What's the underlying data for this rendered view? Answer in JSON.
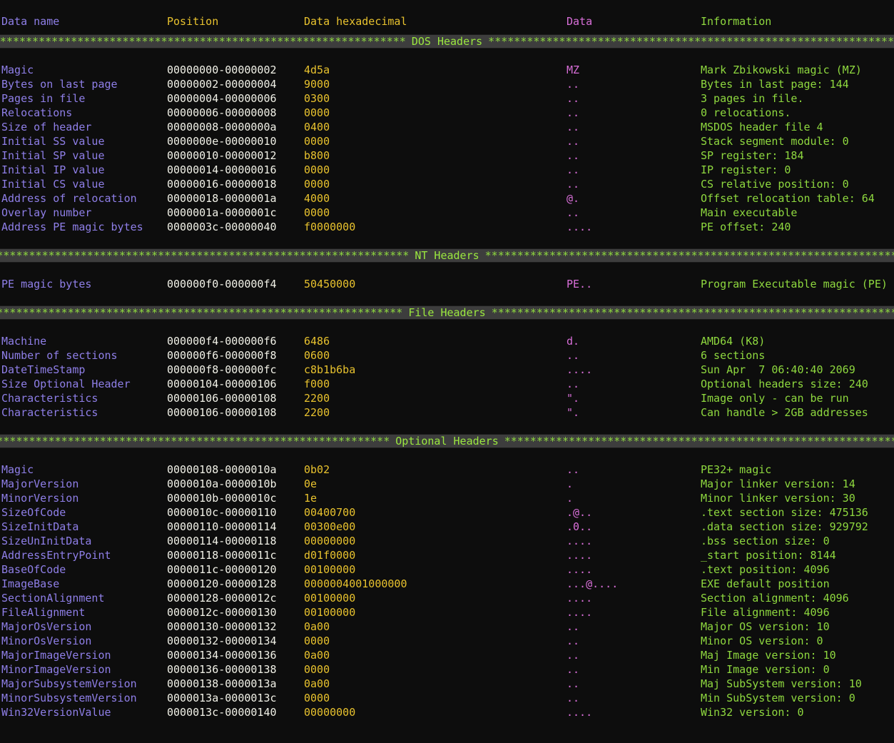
{
  "window": {
    "type": "terminal",
    "background": "#0d0d0d",
    "title": "PE file header dump"
  },
  "colors": {
    "data_name": "#8f7fe8",
    "position": "#f2f2e8",
    "data_hex": "#e8c22e",
    "data_ascii": "#d96fd9",
    "information": "#8fd93f",
    "separator_bar": "#3d3d3d",
    "background": "#0d0d0d"
  },
  "columns": {
    "data_name": "Data name",
    "position": "Position",
    "data_hexadecimal": "Data hexadecimal",
    "data": "Data",
    "information": "Information"
  },
  "sections": [
    {
      "title": "DOS Headers",
      "rows": [
        {
          "name": "Magic",
          "position": "00000000-00000002",
          "hex": "4d5a",
          "data": "MZ",
          "info": "Mark Zbikowski magic (MZ)"
        },
        {
          "name": "Bytes on last page",
          "position": "00000002-00000004",
          "hex": "9000",
          "data": "..",
          "info": "Bytes in last page: 144"
        },
        {
          "name": "Pages in file",
          "position": "00000004-00000006",
          "hex": "0300",
          "data": "..",
          "info": "3 pages in file."
        },
        {
          "name": "Relocations",
          "position": "00000006-00000008",
          "hex": "0000",
          "data": "..",
          "info": "0 relocations."
        },
        {
          "name": "Size of header",
          "position": "00000008-0000000a",
          "hex": "0400",
          "data": "..",
          "info": "MSDOS header file 4"
        },
        {
          "name": "Initial SS value",
          "position": "0000000e-00000010",
          "hex": "0000",
          "data": "..",
          "info": "Stack segment module: 0"
        },
        {
          "name": "Initial SP value",
          "position": "00000010-00000012",
          "hex": "b800",
          "data": "..",
          "info": "SP register: 184"
        },
        {
          "name": "Initial IP value",
          "position": "00000014-00000016",
          "hex": "0000",
          "data": "..",
          "info": "IP register: 0"
        },
        {
          "name": "Initial CS value",
          "position": "00000016-00000018",
          "hex": "0000",
          "data": "..",
          "info": "CS relative position: 0"
        },
        {
          "name": "Address of relocation",
          "position": "00000018-0000001a",
          "hex": "4000",
          "data": "@.",
          "info": "Offset relocation table: 64"
        },
        {
          "name": "Overlay number",
          "position": "0000001a-0000001c",
          "hex": "0000",
          "data": "..",
          "info": "Main executable"
        },
        {
          "name": "Address PE magic bytes",
          "position": "0000003c-00000040",
          "hex": "f0000000",
          "data": "....",
          "info": "PE offset: 240"
        }
      ]
    },
    {
      "title": "NT Headers",
      "rows": [
        {
          "name": "PE magic bytes",
          "position": "000000f0-000000f4",
          "hex": "50450000",
          "data": "PE..",
          "info": "Program Executable magic (PE)"
        }
      ]
    },
    {
      "title": "File Headers",
      "rows": [
        {
          "name": "Machine",
          "position": "000000f4-000000f6",
          "hex": "6486",
          "data": "d.",
          "info": "AMD64 (K8)"
        },
        {
          "name": "Number of sections",
          "position": "000000f6-000000f8",
          "hex": "0600",
          "data": "..",
          "info": "6 sections"
        },
        {
          "name": "DateTimeStamp",
          "position": "000000f8-000000fc",
          "hex": "c8b1b6ba",
          "data": "....",
          "info": "Sun Apr  7 06:40:40 2069"
        },
        {
          "name": "Size Optional Header",
          "position": "00000104-00000106",
          "hex": "f000",
          "data": "..",
          "info": "Optional headers size: 240"
        },
        {
          "name": "Characteristics",
          "position": "00000106-00000108",
          "hex": "2200",
          "data": "\".",
          "info": "Image only - can be run"
        },
        {
          "name": "Characteristics",
          "position": "00000106-00000108",
          "hex": "2200",
          "data": "\".",
          "info": "Can handle > 2GB addresses"
        }
      ]
    },
    {
      "title": "Optional Headers",
      "rows": [
        {
          "name": "Magic",
          "position": "00000108-0000010a",
          "hex": "0b02",
          "data": "..",
          "info": "PE32+ magic"
        },
        {
          "name": "MajorVersion",
          "position": "0000010a-0000010b",
          "hex": "0e",
          "data": ".",
          "info": "Major linker version: 14"
        },
        {
          "name": "MinorVersion",
          "position": "0000010b-0000010c",
          "hex": "1e",
          "data": ".",
          "info": "Minor linker version: 30"
        },
        {
          "name": "SizeOfCode",
          "position": "0000010c-00000110",
          "hex": "00400700",
          "data": ".@..",
          "info": ".text section size: 475136"
        },
        {
          "name": "SizeInitData",
          "position": "00000110-00000114",
          "hex": "00300e00",
          "data": ".0..",
          "info": ".data section size: 929792"
        },
        {
          "name": "SizeUnInitData",
          "position": "00000114-00000118",
          "hex": "00000000",
          "data": "....",
          "info": ".bss section size: 0"
        },
        {
          "name": "AddressEntryPoint",
          "position": "00000118-0000011c",
          "hex": "d01f0000",
          "data": "....",
          "info": "_start position: 8144"
        },
        {
          "name": "BaseOfCode",
          "position": "0000011c-00000120",
          "hex": "00100000",
          "data": "....",
          "info": ".text position: 4096"
        },
        {
          "name": "ImageBase",
          "position": "00000120-00000128",
          "hex": "0000004001000000",
          "data": "...@....",
          "info": "EXE default position"
        },
        {
          "name": "SectionAlignment",
          "position": "00000128-0000012c",
          "hex": "00100000",
          "data": "....",
          "info": "Section alignment: 4096"
        },
        {
          "name": "FileAlignment",
          "position": "0000012c-00000130",
          "hex": "00100000",
          "data": "....",
          "info": "File alignment: 4096"
        },
        {
          "name": "MajorOsVersion",
          "position": "00000130-00000132",
          "hex": "0a00",
          "data": "..",
          "info": "Major OS version: 10"
        },
        {
          "name": "MinorOsVersion",
          "position": "00000132-00000134",
          "hex": "0000",
          "data": "..",
          "info": "Minor OS version: 0"
        },
        {
          "name": "MajorImageVersion",
          "position": "00000134-00000136",
          "hex": "0a00",
          "data": "..",
          "info": "Maj Image version: 10"
        },
        {
          "name": "MinorImageVersion",
          "position": "00000136-00000138",
          "hex": "0000",
          "data": "..",
          "info": "Min Image version: 0"
        },
        {
          "name": "MajorSubsystemVersion",
          "position": "00000138-0000013a",
          "hex": "0a00",
          "data": "..",
          "info": "Maj SubSystem version: 10"
        },
        {
          "name": "MinorSubsystemVersion",
          "position": "0000013a-0000013c",
          "hex": "0000",
          "data": "..",
          "info": "Min SubSystem version: 0"
        },
        {
          "name": "Win32VersionValue",
          "position": "0000013c-00000140",
          "hex": "00000000",
          "data": "....",
          "info": "Win32 version: 0"
        }
      ]
    }
  ]
}
